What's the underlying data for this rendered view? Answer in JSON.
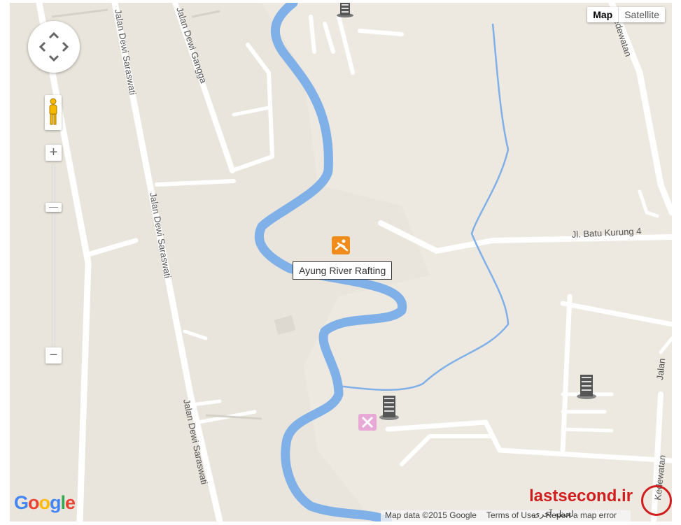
{
  "map_type": {
    "map_label": "Map",
    "satellite_label": "Satellite",
    "selected": "Map"
  },
  "zoom": {
    "in_label": "+",
    "out_label": "−"
  },
  "roads": {
    "dewi_saraswati_1": "Jalan Dewi Saraswati",
    "dewi_saraswati_2": "Jalan Dewi Saraswati",
    "dewi_saraswati_3": "Jalan Dewi Saraswati",
    "dewi_gangga": "Jalan Dewi Gangga",
    "batu_kurung": "Jl. Batu Kurung 4",
    "kedewatan_top": "Kedewatan",
    "kedewatan_bottom": "Kedewatan",
    "jalan_right": "Jalan"
  },
  "poi": {
    "label": "Ayung River Rafting",
    "icon": "rafting-icon"
  },
  "footer": {
    "map_data": "Map data ©2015 Google",
    "terms": "Terms of Use",
    "report": "Report a map error"
  },
  "logo": {
    "google": "Google"
  },
  "watermark": {
    "site": "lastsecond.ir",
    "subtitle": "لحظه آخری"
  },
  "colors": {
    "land": "#e8e4dc",
    "road": "#ffffff",
    "river": "#7fb0e8",
    "poi": "#f08c1c"
  }
}
